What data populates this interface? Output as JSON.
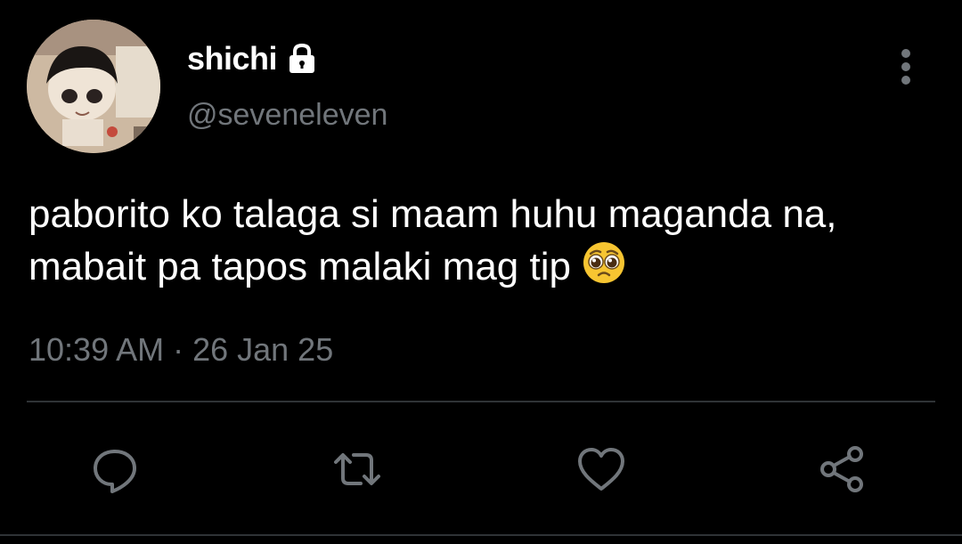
{
  "author": {
    "display_name": "shichi",
    "handle": "@seveneleven",
    "protected": true
  },
  "tweet": {
    "text": "paborito ko talaga si maam huhu maganda na, mabait pa tapos malaki mag tip ",
    "emoji": "pleading-face",
    "timestamp": "10:39 AM · 26 Jan 25"
  },
  "actions": [
    {
      "name": "reply",
      "icon": "reply-icon"
    },
    {
      "name": "retweet",
      "icon": "retweet-icon"
    },
    {
      "name": "like",
      "icon": "heart-icon"
    },
    {
      "name": "share",
      "icon": "share-icon"
    }
  ],
  "colors": {
    "background": "#000000",
    "text_primary": "#ffffff",
    "text_secondary": "#71767b",
    "divider": "#2f3336"
  }
}
